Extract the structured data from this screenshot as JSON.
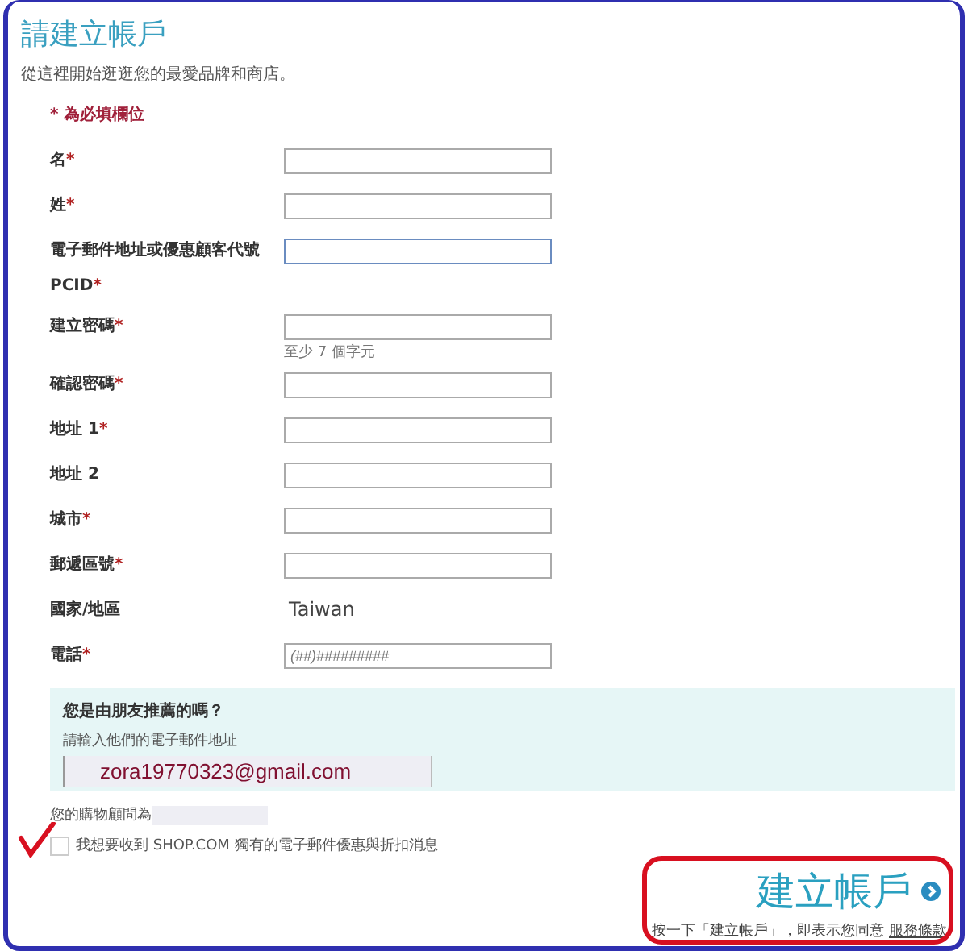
{
  "title": "請建立帳戶",
  "subtitle": "從這裡開始逛逛您的最愛品牌和商店。",
  "required_note": "* 為必填欄位",
  "fields": [
    {
      "kind": "input",
      "label": "名",
      "mark": "*",
      "focused": false
    },
    {
      "kind": "input",
      "label": "姓",
      "mark": "*",
      "focused": false
    },
    {
      "kind": "input",
      "label": "電子郵件地址或優惠顧客代號 PCID",
      "mark": "*",
      "focused": true
    },
    {
      "kind": "input",
      "label": "建立密碼",
      "mark": "*",
      "focused": false,
      "hint": "至少 7 個字元"
    },
    {
      "kind": "input",
      "label": "確認密碼",
      "mark": "*",
      "focused": false
    },
    {
      "kind": "input",
      "label": "地址 1",
      "mark": "*",
      "focused": false
    },
    {
      "kind": "input",
      "label": "地址 2",
      "focused": false
    },
    {
      "kind": "input",
      "label": "城市",
      "mark": "*",
      "focused": false
    },
    {
      "kind": "input",
      "label": "郵遞區號",
      "mark": "*",
      "focused": false
    },
    {
      "kind": "static",
      "label": "國家/地區",
      "value": "Taiwan"
    },
    {
      "kind": "input",
      "label": "電話",
      "mark": "*",
      "focused": false,
      "placeholder": "(##)#########"
    }
  ],
  "referral": {
    "question": "您是由朋友推薦的嗎？",
    "prompt": "請輸入他們的電子郵件地址",
    "value": "zora19770323@gmail.com"
  },
  "advisor_label": "您的購物顧問為",
  "newsletter": {
    "label": "我想要收到 SHOP.COM 獨有的電子郵件優惠與折扣消息",
    "checked": false
  },
  "submit": "建立帳戶",
  "terms": {
    "text": "按一下「建立帳戶」，即表示您同意",
    "link": "服務條款"
  }
}
